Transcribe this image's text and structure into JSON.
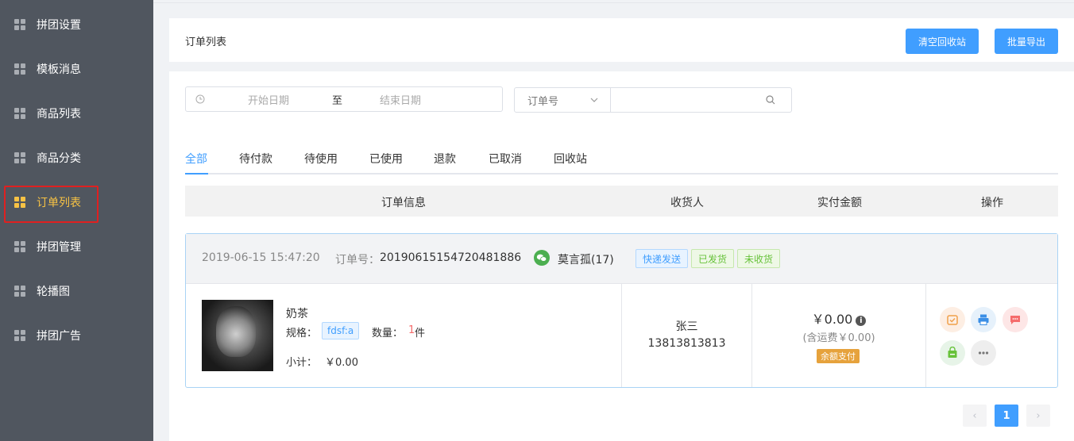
{
  "sidebar": {
    "items": [
      {
        "label": "拼团设置"
      },
      {
        "label": "模板消息"
      },
      {
        "label": "商品列表"
      },
      {
        "label": "商品分类"
      },
      {
        "label": "订单列表",
        "active": true
      },
      {
        "label": "拼团管理"
      },
      {
        "label": "轮播图"
      },
      {
        "label": "拼团广告"
      }
    ]
  },
  "header": {
    "title": "订单列表",
    "clear_recycle_label": "清空回收站",
    "batch_export_label": "批量导出"
  },
  "filters": {
    "start_placeholder": "开始日期",
    "range_separator": "至",
    "end_placeholder": "结束日期",
    "search_type": "订单号",
    "search_value": ""
  },
  "tabs": [
    {
      "label": "全部",
      "active": true
    },
    {
      "label": "待付款"
    },
    {
      "label": "待使用"
    },
    {
      "label": "已使用"
    },
    {
      "label": "退款"
    },
    {
      "label": "已取消"
    },
    {
      "label": "回收站"
    }
  ],
  "table": {
    "columns": [
      "订单信息",
      "收货人",
      "实付金额",
      "操作"
    ]
  },
  "order": {
    "time": "2019-06-15 15:47:20",
    "order_no_label": "订单号：",
    "order_no": "20190615154720481886",
    "buyer": "莫言孤(17)",
    "tags": [
      "快递发送",
      "已发货",
      "未收货"
    ],
    "product_name": "奶茶",
    "spec_label": "规格：",
    "spec_value": "fdsf:a",
    "qty_label": "数量：",
    "qty_value": "1",
    "qty_unit": "件",
    "subtotal_label": "小计：",
    "subtotal_value": "￥0.00",
    "receiver_name": "张三",
    "receiver_phone": "13813813813",
    "paid_amount": "￥0.00",
    "shipping_note": "(含运费￥0.00)",
    "pay_method": "余额支付",
    "actions": [
      "confirm-icon",
      "print-icon",
      "message-icon",
      "shop-icon",
      "more-icon"
    ]
  },
  "pagination": {
    "current": "1",
    "prev": "‹",
    "next": "›"
  },
  "colors": {
    "primary": "#409eff",
    "sidebar_bg": "#50565f",
    "active_menu": "#f7c244",
    "highlight_box": "#e02020"
  }
}
